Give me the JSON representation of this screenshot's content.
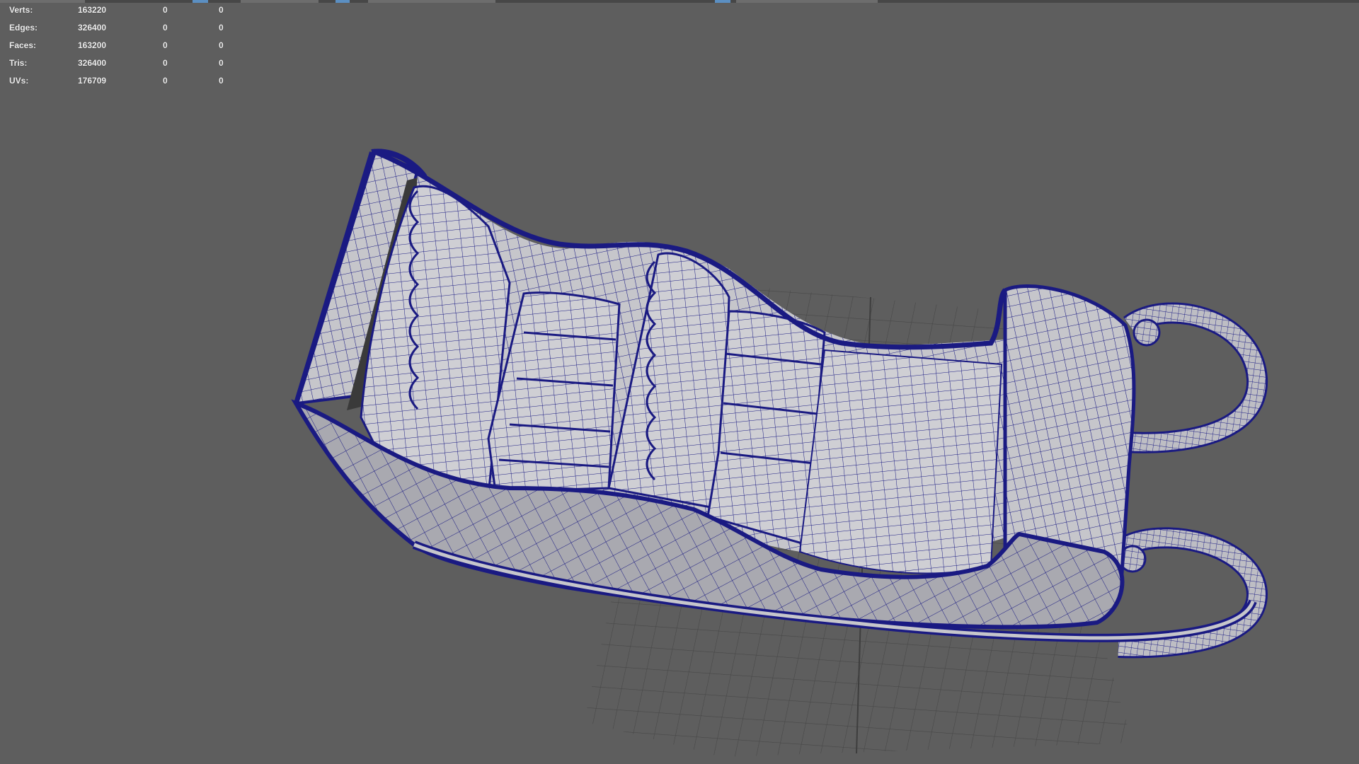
{
  "heads_up_display": {
    "poly_count": [
      {
        "label": "Verts:",
        "total": "163220",
        "selected": "0",
        "component": "0"
      },
      {
        "label": "Edges:",
        "total": "326400",
        "selected": "0",
        "component": "0"
      },
      {
        "label": "Faces:",
        "total": "163200",
        "selected": "0",
        "component": "0"
      },
      {
        "label": "Tris:",
        "total": "326400",
        "selected": "0",
        "component": "0"
      },
      {
        "label": "UVs:",
        "total": "176709",
        "selected": "0",
        "component": "0"
      }
    ]
  },
  "viewport": {
    "background_color": "#5e5e5e",
    "grid_color": "#474747",
    "wireframe_color": "#1a1a82",
    "model_surface_color": "#c6c6cb"
  }
}
